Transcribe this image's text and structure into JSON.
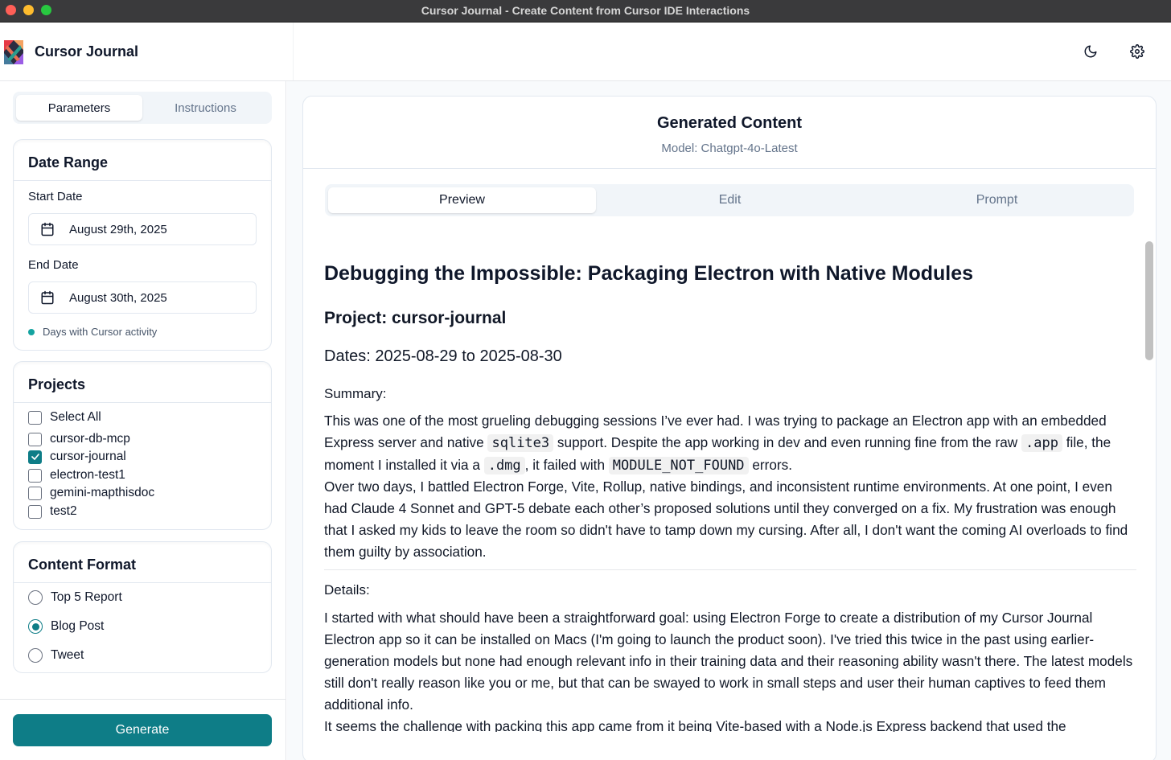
{
  "window": {
    "title": "Cursor Journal - Create Content from Cursor IDE Interactions"
  },
  "header": {
    "app_name": "Cursor Journal",
    "moon_icon": "moon-icon",
    "gear_icon": "gear-icon"
  },
  "sidebar": {
    "tabs": [
      {
        "label": "Parameters",
        "active": true
      },
      {
        "label": "Instructions",
        "active": false
      }
    ],
    "date_range": {
      "title": "Date Range",
      "start_label": "Start Date",
      "start_value": "August 29th, 2025",
      "end_label": "End Date",
      "end_value": "August 30th, 2025",
      "activity_legend": "Days with Cursor activity"
    },
    "projects": {
      "title": "Projects",
      "select_all": "Select All",
      "items": [
        {
          "label": "cursor-db-mcp",
          "checked": false
        },
        {
          "label": "cursor-journal",
          "checked": true
        },
        {
          "label": "electron-test1",
          "checked": false
        },
        {
          "label": "gemini-mapthisdoc",
          "checked": false
        },
        {
          "label": "test2",
          "checked": false
        }
      ]
    },
    "content_format": {
      "title": "Content Format",
      "options": [
        {
          "label": "Top 5 Report",
          "selected": false
        },
        {
          "label": "Blog Post",
          "selected": true
        },
        {
          "label": "Tweet",
          "selected": false
        }
      ]
    },
    "generate_label": "Generate"
  },
  "main": {
    "title": "Generated Content",
    "model": "Model: Chatgpt-4o-Latest",
    "tabs": [
      {
        "label": "Preview",
        "active": true
      },
      {
        "label": "Edit",
        "active": false
      },
      {
        "label": "Prompt",
        "active": false
      }
    ],
    "article": {
      "h1": "Debugging the Impossible: Packaging Electron with Native Modules",
      "project": "Project: cursor-journal",
      "dates": "Dates: 2025-08-29 to 2025-08-30",
      "summary_label": "Summary:",
      "summary_p1": {
        "t1": "This was one of the most grueling debugging sessions I’ve ever had. I was trying to package an Electron app with an embedded Express server and native ",
        "c1": "sqlite3",
        "t2": " support. Despite the app working in dev and even running fine from the raw ",
        "c2": ".app",
        "t3": " file, the moment I installed it via a ",
        "c3": ".dmg",
        "t4": ", it failed with ",
        "c4": "MODULE_NOT_FOUND",
        "t5": " errors."
      },
      "summary_p2": "Over two days, I battled Electron Forge, Vite, Rollup, native bindings, and inconsistent runtime environments. At one point, I even had Claude 4 Sonnet and GPT-5 debate each other’s proposed solutions until they converged on a fix. My frustration was enough that I asked my kids to leave the room so didn't have to tamp down my cursing. After all, I don't want the coming AI overloads to find them guilty by association.",
      "details_label": "Details:",
      "details_p1": "I started with what should have been a straightforward goal: using Electron Forge to create a distribution of my Cursor Journal Electron app so it can be installed on Macs (I'm going to launch the product soon). I've tried this twice in the past using earlier-generation models but none had enough relevant info in their training data and their reasoning ability wasn't there. The latest models still don't really reason like you or me, but that can be swayed to work in small steps and user their human captives to feed them additional info.",
      "details_p2": "It seems the challenge with packing this app came from it being Vite-based with a Node.js Express backend that used the"
    }
  },
  "colors": {
    "accent": "#0e7d87",
    "activity_dot": "#14a3a0"
  }
}
